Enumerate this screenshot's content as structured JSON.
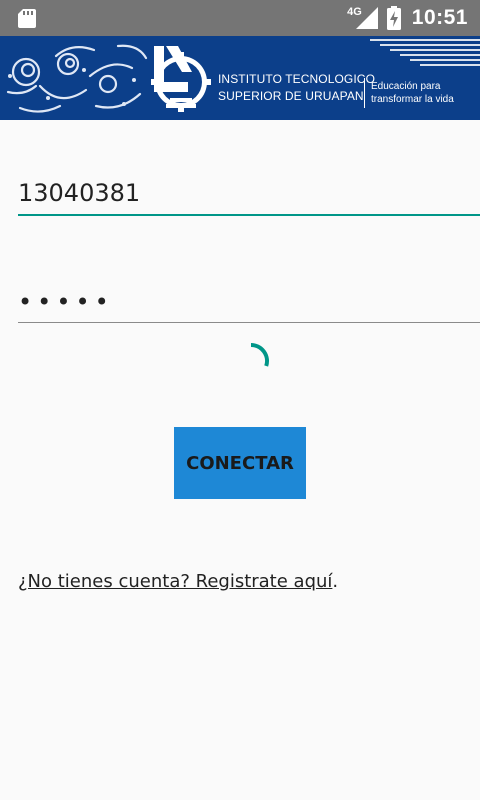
{
  "status_bar": {
    "left_icon": "sd-card-icon",
    "network_type": "4G",
    "signal_icon": "cell-signal-icon",
    "battery_icon": "battery-charging-icon",
    "time": "10:51"
  },
  "banner": {
    "institution_name": "INSTITUTO TECNOLOGICO\nSUPERIOR  DE  URUAPAN",
    "slogan": "Educación para\ntransformar la vida",
    "colors": {
      "background": "#0c3f8a",
      "text": "#ffffff"
    }
  },
  "login_form": {
    "username_value": "13040381",
    "password_value": "•••••",
    "loading_indicator": "progress-spinner-icon",
    "connect_label": "CONECTAR",
    "register_text": "¿No tienes cuenta? Registrate aquí",
    "register_trailing": "."
  },
  "colors": {
    "accent": "#009688",
    "button": "#1e88d6",
    "status_bar": "#757575",
    "background": "#fafafa"
  }
}
